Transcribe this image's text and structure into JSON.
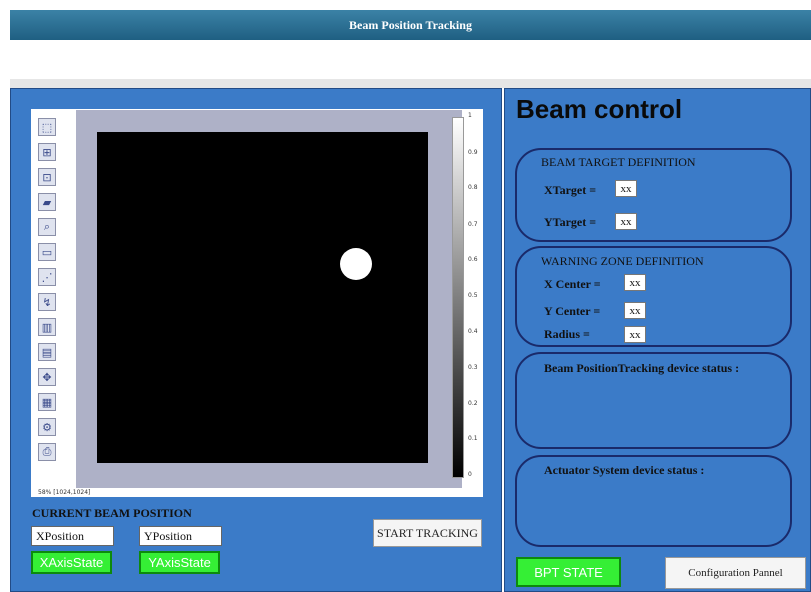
{
  "window": {
    "title": "Beam Position Tracking"
  },
  "viewer": {
    "toolbar_icons": [
      "select-icon",
      "zoom-box-icon",
      "zoom-fit-icon",
      "open-icon",
      "zoom-in-icon",
      "window-icon",
      "chart-icon",
      "axis-icon",
      "histogram-icon",
      "stats-icon",
      "pan-icon",
      "colormap-icon",
      "settings-icon",
      "print-icon"
    ],
    "colorbar_ticks": [
      "1",
      "0.9",
      "0.8",
      "0.7",
      "0.6",
      "0.5",
      "0.4",
      "0.3",
      "0.2",
      "0.1",
      "0"
    ],
    "zoom_label": "58% [1024,1024]"
  },
  "current_beam": {
    "title": "CURRENT BEAM POSITION",
    "xposition": "XPosition",
    "yposition": "YPosition",
    "xaxis_state": "XAxisState",
    "yaxis_state": "YAxisState",
    "start_tracking": "START TRACKING"
  },
  "beam_control": {
    "title": "Beam control",
    "target": {
      "title": "BEAM TARGET DEFINITION",
      "xtarget_label": "XTarget  =",
      "ytarget_label": "YTarget  =",
      "xtarget_value": "xx",
      "ytarget_value": "xx"
    },
    "warning": {
      "title": "WARNING ZONE DEFINITION",
      "xcenter_label": "X Center  =",
      "ycenter_label": "Y Center  =",
      "radius_label": "Radius    =",
      "xcenter_value": "xx",
      "ycenter_value": "xx",
      "radius_value": "xx"
    },
    "bpt_status": "Beam PositionTracking device status :",
    "actuator_status": "Actuator System device status :",
    "bpt_state": "BPT STATE",
    "config_button": "Configuration Pannel"
  }
}
